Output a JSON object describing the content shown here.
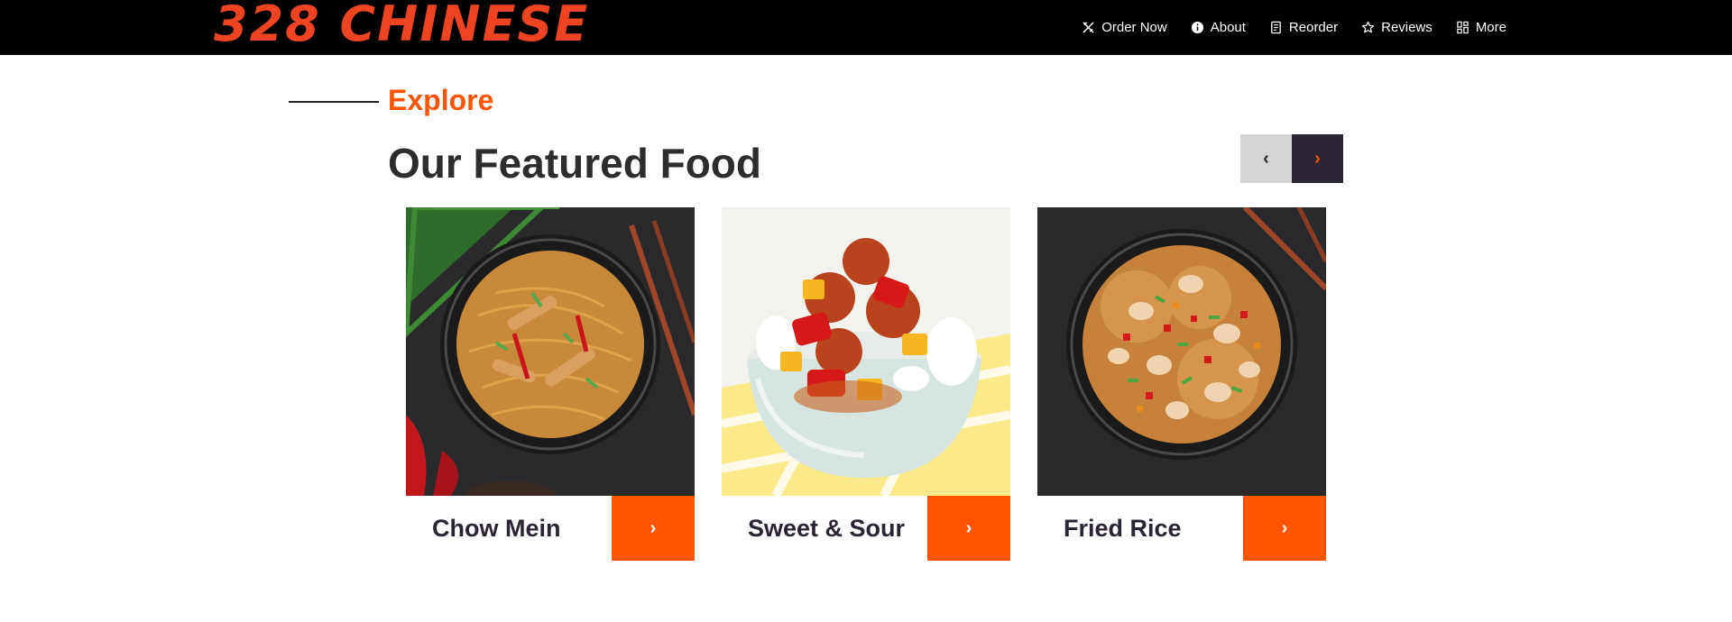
{
  "brand": {
    "logo_text": "328 CHINESE",
    "accent": "#ff5500",
    "logo_color": "#ee4422"
  },
  "nav": [
    {
      "label": "Order Now",
      "icon": "utensils-icon"
    },
    {
      "label": "About",
      "icon": "info-icon"
    },
    {
      "label": "Reorder",
      "icon": "receipt-icon"
    },
    {
      "label": "Reviews",
      "icon": "star-icon"
    },
    {
      "label": "More",
      "icon": "grid-icon"
    }
  ],
  "section": {
    "eyebrow": "Explore",
    "title": "Our Featured Food"
  },
  "carousel": {
    "prev_label": "‹",
    "next_label": "›"
  },
  "cards": [
    {
      "title": "Chow Mein",
      "button_label": "›",
      "image": "chow-mein-photo"
    },
    {
      "title": "Sweet & Sour",
      "button_label": "›",
      "image": "sweet-and-sour-photo"
    },
    {
      "title": "Fried Rice",
      "button_label": "›",
      "image": "fried-rice-photo"
    }
  ]
}
